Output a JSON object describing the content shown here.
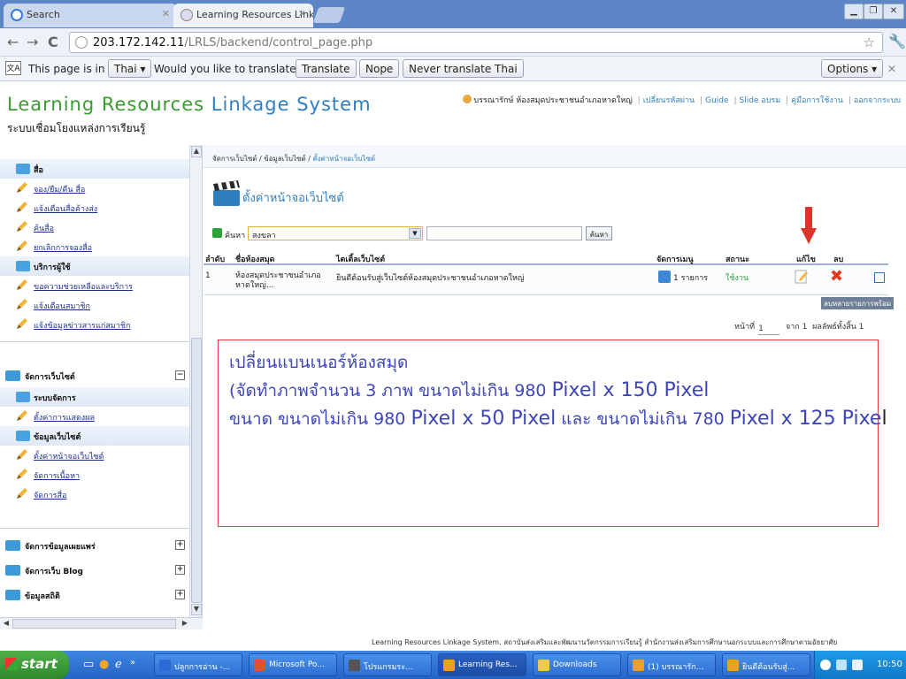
{
  "browser": {
    "tabs": [
      {
        "label": "Search",
        "active": false
      },
      {
        "label": "Learning Resources Linkage Sy",
        "active": true
      }
    ],
    "url_host": "203.172.142.11",
    "url_path": "/LRLS/backend/control_page.php",
    "translate_bar": {
      "prefix": "This page is in",
      "language": "Thai",
      "question": "Would you like to translate it?",
      "translate_label": "Translate",
      "nope_label": "Nope",
      "never_label": "Never translate Thai",
      "options_label": "Options"
    }
  },
  "site": {
    "brand_part1": "Learning Resources",
    "brand_part2": "Linkage System",
    "brand_sub": "ระบบเชื่อมโยงแหล่งการเรียนรู้",
    "user": "บรรณารักษ์ ห้องสมุดประชาชนอำเภอหาดใหญ่",
    "top_links": [
      "เปลี่ยนรหัสผ่าน",
      "Guide",
      "Slide อบรม",
      "คู่มือการใช้งาน",
      "ออกจากระบบ"
    ]
  },
  "sidebar": {
    "section1_items": [
      {
        "type": "head",
        "label": "สื่อ"
      },
      {
        "type": "sub",
        "label": "จอง/ยืม/คืน สื่อ"
      },
      {
        "type": "sub",
        "label": "แจ้งเตือนสื่อค้างส่ง"
      },
      {
        "type": "sub",
        "label": "ค้นสื่อ"
      },
      {
        "type": "sub",
        "label": "ยกเลิกการจองสื่อ"
      },
      {
        "type": "head",
        "label": "บริการผู้ใช้"
      },
      {
        "type": "sub",
        "label": "ขอความช่วยเหลือและบริการ"
      },
      {
        "type": "sub",
        "label": "แจ้งเตือนสมาชิก"
      },
      {
        "type": "sub",
        "label": "แจ้งข้อมูลข่าวสารแก่สมาชิก"
      }
    ],
    "web_section": {
      "label": "จัดการเว็บไซต์",
      "toggle": "−",
      "items": [
        {
          "type": "head",
          "label": "ระบบจัดการ"
        },
        {
          "type": "sub",
          "label": "ตั้งค่าการแสดงผล"
        },
        {
          "type": "head",
          "label": "ข้อมูลเว็บไซต์"
        },
        {
          "type": "sub",
          "label": "ตั้งค่าหน้าจอเว็บไซต์"
        },
        {
          "type": "sub",
          "label": "จัดการเนื้อหา"
        },
        {
          "type": "sub",
          "label": "จัดการสื่อ"
        }
      ]
    },
    "collapsed_sections": [
      {
        "label": "จัดการข้อมูลเผยแพร่",
        "toggle": "+"
      },
      {
        "label": "จัดการเว็บ Blog",
        "toggle": "+"
      },
      {
        "label": "ข้อมูลสถิติ",
        "toggle": "+"
      }
    ]
  },
  "main": {
    "breadcrumb": [
      "จัดการเว็บไซต์",
      "ข้อมูลเว็บไซต์",
      "ตั้งค่าหน้าจอเว็บไซต์"
    ],
    "page_title": "ตั้งค่าหน้าจอเว็บไซต์",
    "search": {
      "label": "ค้นหา :",
      "selected": "สงขลา",
      "button": "ค้นหา"
    },
    "table": {
      "headers": [
        "ลำดับ",
        "ชื่อห้องสมุด",
        "ไตเติ้ลเว็บไซต์",
        "จัดการเมนู",
        "สถานะ",
        "แก้ไข",
        "ลบ"
      ],
      "rows": [
        {
          "index": "1",
          "library_line1": "ห้องสมุดประชาชนอำเภอ",
          "library_line2": "หาดใหญ่...",
          "title": "ยินดีต้อนรับสู่เว็บไซต์ห้องสมุดประชาชนอำเภอหาดใหญ่",
          "menu": "1 รายการ",
          "status": "ใช้งาน"
        }
      ]
    },
    "delete_multi": "ลบหลายรายการพร้อม",
    "pager": {
      "page_label": "หน้าที่",
      "page_value": "1",
      "of_text": "จาก 1",
      "total_text": "ผลลัพธ์ทั้งสิ้น 1"
    },
    "note": {
      "line1": "เปลี่ยนแบนเนอร์ห้องสมุด",
      "line2_a": "(จัดทำภาพจำนวน 3 ภาพ ขนาดไม่เกิน 980",
      "line2_b": "Pixel x 150 Pixel",
      "line3_a": "ขนาด ขนาดไม่เกิน 980",
      "line3_b": "Pixel x 50 Pixel",
      "line3_c": "และ ขนาดไม่เกิน 780",
      "line3_d": "Pixel x 125 Pixe",
      "line3_e": "l"
    }
  },
  "footer": "Learning Resources Linkage System. สถาบันส่งเสริมและพัฒนานวัตกรรมการเรียนรู้ สำนักงานส่งเสริมการศึกษานอกระบบและการศึกษาตามอัธยาศัย",
  "taskbar": {
    "start_label": "start",
    "items": [
      {
        "label": "ปลูกการอ่าน -...",
        "color": "#2e6ad6"
      },
      {
        "label": "Microsoft Po...",
        "color": "#e0512c"
      },
      {
        "label": "โปรแกรมระ...",
        "color": "#555555"
      },
      {
        "label": "Learning Res...",
        "color": "#f0a020"
      },
      {
        "label": "Downloads",
        "color": "#f3c94a"
      },
      {
        "label": "(1) บรรณารัก...",
        "color": "#f0a020"
      },
      {
        "label": "ยินดีต้อนรับสู่...",
        "color": "#f0a020"
      }
    ],
    "clock": "10:50"
  },
  "colors": {
    "brand_green": "#3a9c30",
    "brand_blue": "#2f7fc0",
    "note_border": "#d74040",
    "note_text": "#3e45b8"
  }
}
